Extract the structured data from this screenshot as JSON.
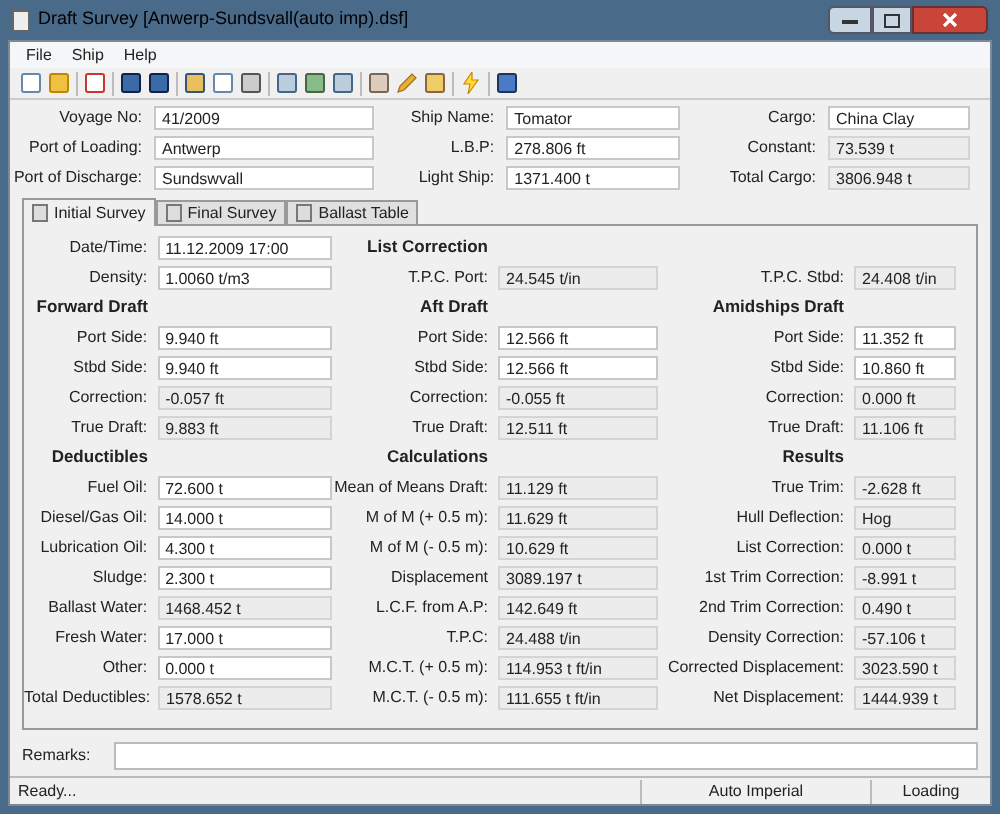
{
  "window": {
    "title": "Draft Survey [Anwerp-Sundsvall(auto imp).dsf]"
  },
  "menu": [
    "File",
    "Ship",
    "Help"
  ],
  "header": [
    [
      {
        "label": "Voyage No:",
        "value": "41/2009",
        "readonly": false
      },
      {
        "label": "Port of Loading:",
        "value": "Antwerp",
        "readonly": false
      },
      {
        "label": "Port of Discharge:",
        "value": "Sundswvall",
        "readonly": false
      }
    ],
    [
      {
        "label": "Ship Name:",
        "value": "Tomator",
        "readonly": false
      },
      {
        "label": "L.B.P:",
        "value": "278.806 ft",
        "readonly": false
      },
      {
        "label": "Light Ship:",
        "value": "1371.400 t",
        "readonly": false
      }
    ],
    [
      {
        "label": "Cargo:",
        "value": "China Clay",
        "readonly": false
      },
      {
        "label": "Constant:",
        "value": "73.539 t",
        "readonly": true
      },
      {
        "label": "Total Cargo:",
        "value": "3806.948 t",
        "readonly": true
      }
    ]
  ],
  "tabs": [
    {
      "label": "Initial Survey",
      "selected": true
    },
    {
      "label": "Final Survey",
      "selected": false
    },
    {
      "label": "Ballast Table",
      "selected": false
    }
  ],
  "columns": [
    [
      {
        "kind": "field",
        "label": "Date/Time:",
        "value": "11.12.2009 17:00",
        "readonly": false
      },
      {
        "kind": "field",
        "label": "Density:",
        "value": "1.0060 t/m3",
        "readonly": false
      },
      {
        "kind": "heading",
        "label": "Forward Draft"
      },
      {
        "kind": "field",
        "label": "Port Side:",
        "value": "9.940 ft",
        "readonly": false
      },
      {
        "kind": "field",
        "label": "Stbd Side:",
        "value": "9.940 ft",
        "readonly": false
      },
      {
        "kind": "field",
        "label": "Correction:",
        "value": "-0.057 ft",
        "readonly": true
      },
      {
        "kind": "field",
        "label": "True Draft:",
        "value": "9.883 ft",
        "readonly": true
      },
      {
        "kind": "heading",
        "label": "Deductibles"
      },
      {
        "kind": "field",
        "label": "Fuel Oil:",
        "value": "72.600 t",
        "readonly": false
      },
      {
        "kind": "field",
        "label": "Diesel/Gas Oil:",
        "value": "14.000 t",
        "readonly": false
      },
      {
        "kind": "field",
        "label": "Lubrication Oil:",
        "value": "4.300 t",
        "readonly": false
      },
      {
        "kind": "field",
        "label": "Sludge:",
        "value": "2.300 t",
        "readonly": false
      },
      {
        "kind": "field",
        "label": "Ballast Water:",
        "value": "1468.452 t",
        "readonly": true
      },
      {
        "kind": "field",
        "label": "Fresh Water:",
        "value": "17.000 t",
        "readonly": false
      },
      {
        "kind": "field",
        "label": "Other:",
        "value": "0.000 t",
        "readonly": false
      },
      {
        "kind": "field",
        "label": "Total Deductibles:",
        "value": "1578.652 t",
        "readonly": true
      }
    ],
    [
      {
        "kind": "heading",
        "label": "List Correction"
      },
      {
        "kind": "field",
        "label": "T.P.C. Port:",
        "value": "24.545 t/in",
        "readonly": true
      },
      {
        "kind": "heading",
        "label": "Aft Draft"
      },
      {
        "kind": "field",
        "label": "Port Side:",
        "value": "12.566 ft",
        "readonly": false
      },
      {
        "kind": "field",
        "label": "Stbd Side:",
        "value": "12.566 ft",
        "readonly": false
      },
      {
        "kind": "field",
        "label": "Correction:",
        "value": "-0.055 ft",
        "readonly": true
      },
      {
        "kind": "field",
        "label": "True Draft:",
        "value": "12.511 ft",
        "readonly": true
      },
      {
        "kind": "heading",
        "label": "Calculations"
      },
      {
        "kind": "field",
        "label": "Mean of Means Draft:",
        "value": "11.129 ft",
        "readonly": true
      },
      {
        "kind": "field",
        "label": "M of M (+ 0.5 m):",
        "value": "11.629 ft",
        "readonly": true
      },
      {
        "kind": "field",
        "label": "M of M (- 0.5 m):",
        "value": "10.629 ft",
        "readonly": true
      },
      {
        "kind": "field",
        "label": "Displacement",
        "value": "3089.197 t",
        "readonly": true
      },
      {
        "kind": "field",
        "label": "L.C.F. from A.P:",
        "value": "142.649 ft",
        "readonly": true
      },
      {
        "kind": "field",
        "label": "T.P.C:",
        "value": "24.488 t/in",
        "readonly": true
      },
      {
        "kind": "field",
        "label": "M.C.T. (+ 0.5 m):",
        "value": "114.953 t ft/in",
        "readonly": true
      },
      {
        "kind": "field",
        "label": "M.C.T. (- 0.5 m):",
        "value": "111.655 t ft/in",
        "readonly": true
      }
    ],
    [
      {
        "kind": "field",
        "label": "T.P.C. Stbd:",
        "value": "24.408 t/in",
        "readonly": true
      },
      {
        "kind": "heading",
        "label": "Amidships Draft"
      },
      {
        "kind": "field",
        "label": "Port Side:",
        "value": "11.352 ft",
        "readonly": false
      },
      {
        "kind": "field",
        "label": "Stbd Side:",
        "value": "10.860 ft",
        "readonly": false
      },
      {
        "kind": "field",
        "label": "Correction:",
        "value": "0.000 ft",
        "readonly": true
      },
      {
        "kind": "field",
        "label": "True Draft:",
        "value": "11.106 ft",
        "readonly": true
      },
      {
        "kind": "heading",
        "label": "Results"
      },
      {
        "kind": "field",
        "label": "True Trim:",
        "value": "-2.628 ft",
        "readonly": true
      },
      {
        "kind": "field",
        "label": "Hull Deflection:",
        "value": "Hog",
        "readonly": true
      },
      {
        "kind": "field",
        "label": "List Correction:",
        "value": "0.000 t",
        "readonly": true
      },
      {
        "kind": "field",
        "label": "1st Trim Correction:",
        "value": "-8.991 t",
        "readonly": true
      },
      {
        "kind": "field",
        "label": "2nd Trim Correction:",
        "value": "0.490 t",
        "readonly": true
      },
      {
        "kind": "field",
        "label": "Density Correction:",
        "value": "-57.106 t",
        "readonly": true
      },
      {
        "kind": "field",
        "label": "Corrected Displacement:",
        "value": "3023.590 t",
        "readonly": true
      },
      {
        "kind": "field",
        "label": "Net Displacement:",
        "value": "1444.939 t",
        "readonly": true
      }
    ]
  ],
  "remarks": {
    "label": "Remarks:"
  },
  "status_bar": [
    "Ready...",
    "Auto Imperial",
    "Loading"
  ]
}
